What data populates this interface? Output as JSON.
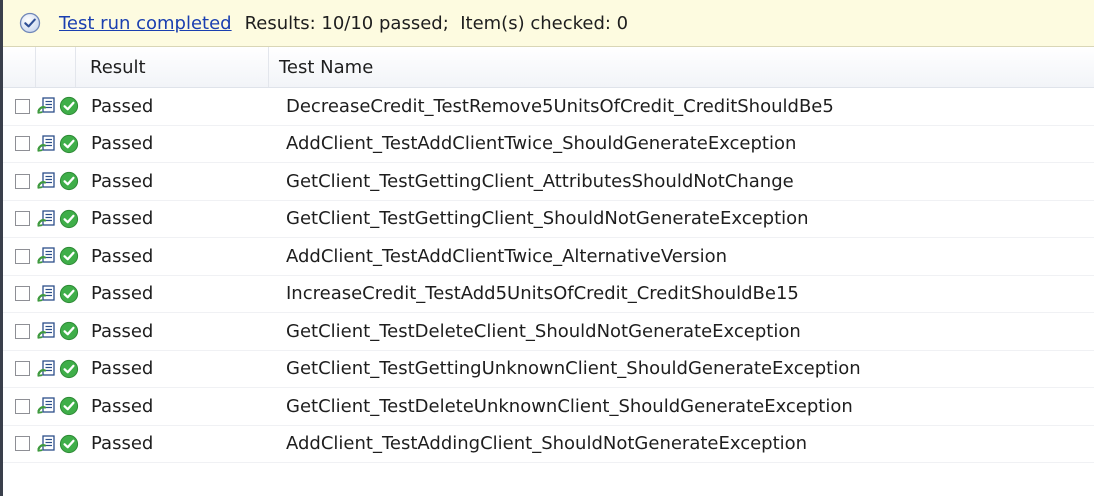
{
  "status": {
    "icon": "status-check-icon",
    "link_text": "Test run completed",
    "results_text": "Results: 10/10 passed;  Item(s) checked: 0"
  },
  "columns": {
    "result": "Result",
    "test_name": "Test Name"
  },
  "colors": {
    "status_bg": "#fdfbe0",
    "link": "#1a3fb0",
    "pass_green": "#3fae49"
  },
  "rows": [
    {
      "result": "Passed",
      "name": "DecreaseCredit_TestRemove5UnitsOfCredit_CreditShouldBe5"
    },
    {
      "result": "Passed",
      "name": "AddClient_TestAddClientTwice_ShouldGenerateException"
    },
    {
      "result": "Passed",
      "name": "GetClient_TestGettingClient_AttributesShouldNotChange"
    },
    {
      "result": "Passed",
      "name": "GetClient_TestGettingClient_ShouldNotGenerateException"
    },
    {
      "result": "Passed",
      "name": "AddClient_TestAddClientTwice_AlternativeVersion"
    },
    {
      "result": "Passed",
      "name": "IncreaseCredit_TestAdd5UnitsOfCredit_CreditShouldBe15"
    },
    {
      "result": "Passed",
      "name": "GetClient_TestDeleteClient_ShouldNotGenerateException"
    },
    {
      "result": "Passed",
      "name": "GetClient_TestGettingUnknownClient_ShouldGenerateException"
    },
    {
      "result": "Passed",
      "name": "GetClient_TestDeleteUnknownClient_ShouldGenerateException"
    },
    {
      "result": "Passed",
      "name": "AddClient_TestAddingClient_ShouldNotGenerateException"
    }
  ]
}
